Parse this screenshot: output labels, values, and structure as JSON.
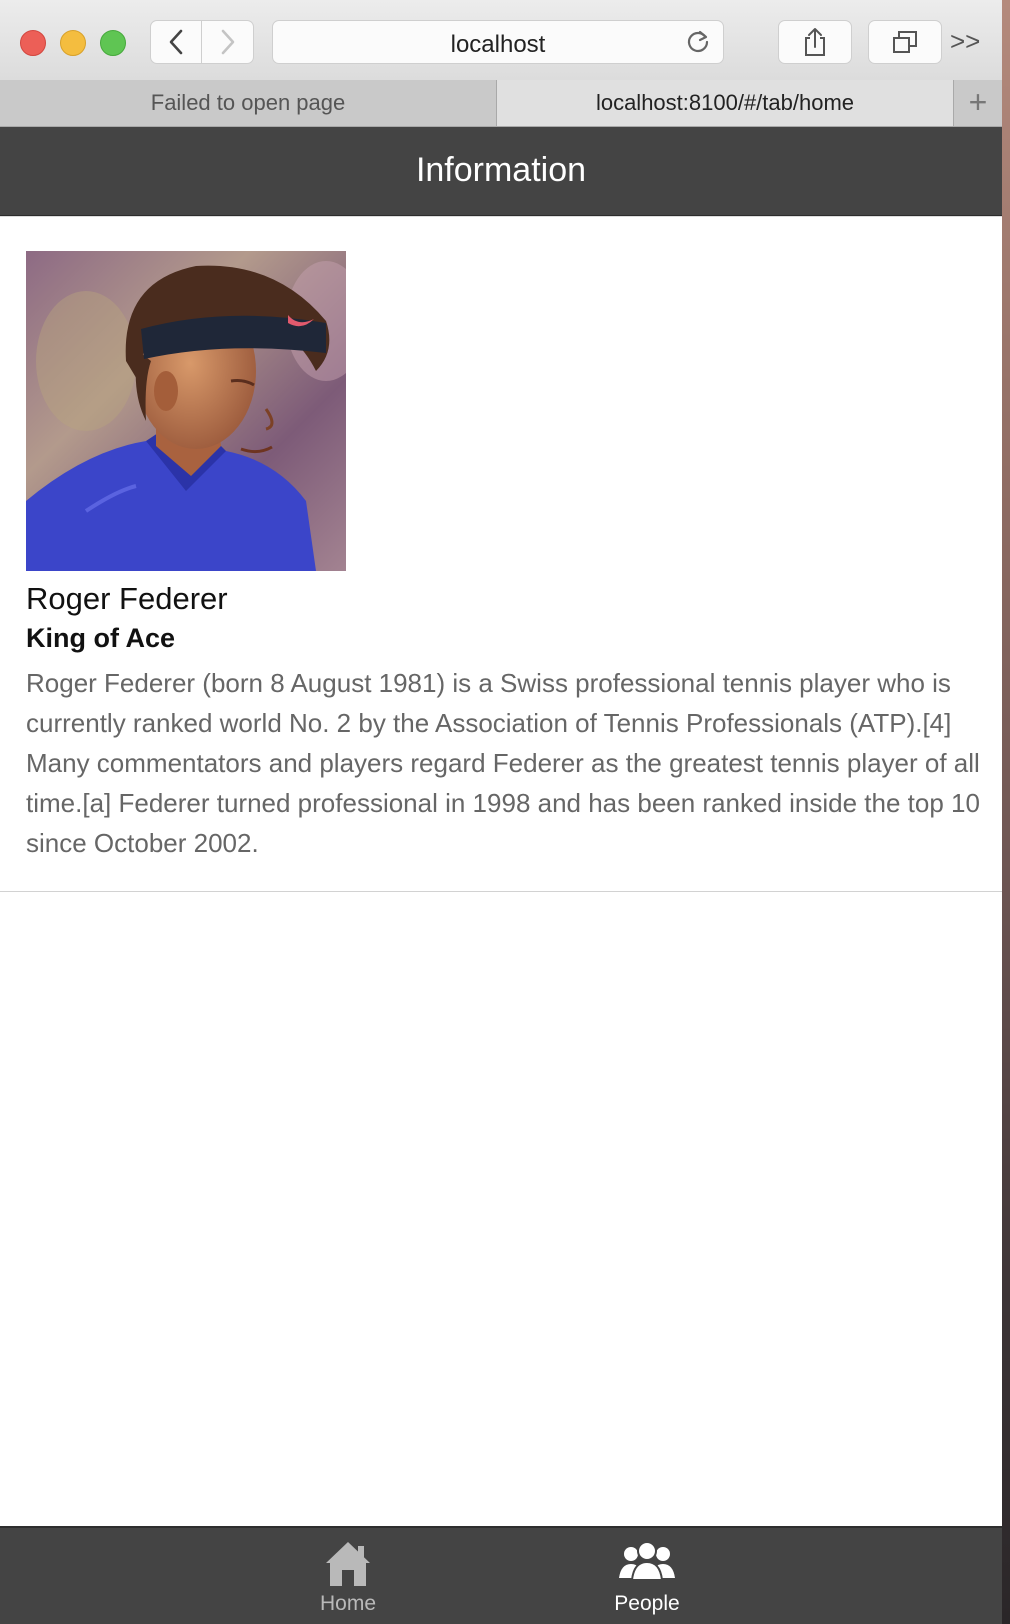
{
  "browser": {
    "address": "localhost",
    "tabs": [
      {
        "label": "Failed to open page"
      },
      {
        "label": "localhost:8100/#/tab/home"
      }
    ],
    "more_label": ">>",
    "new_tab_label": "+"
  },
  "app": {
    "header_title": "Information",
    "profile": {
      "name": "Roger Federer",
      "subtitle": "King of Ace",
      "bio": "Roger Federer (born 8 August 1981) is a Swiss professional tennis player who is currently ranked world No. 2 by the Association of Tennis Professionals (ATP).[4] Many commentators and players regard Federer as the greatest tennis player of all time.[a] Federer turned professional in 1998 and has been ranked inside the top 10 since October 2002."
    },
    "bottom_tabs": [
      {
        "label": "Home",
        "icon": "home-icon",
        "active": false
      },
      {
        "label": "People",
        "icon": "people-icon",
        "active": true
      }
    ]
  },
  "colors": {
    "header_bg": "#444444",
    "tab_active": "#ffffff",
    "tab_inactive": "#b9b9b9",
    "bio_text": "#666666"
  }
}
